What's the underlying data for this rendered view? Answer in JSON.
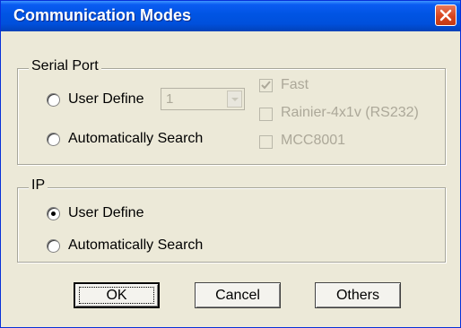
{
  "window": {
    "title": "Communication Modes"
  },
  "serial_port": {
    "group_label": "Serial Port",
    "user_define_label": "User Define",
    "auto_search_label": "Automatically Search",
    "port_value": "1",
    "options": [
      {
        "label": "Fast",
        "checked": true,
        "enabled": false
      },
      {
        "label": "Rainier-4x1v (RS232)",
        "checked": false,
        "enabled": false
      },
      {
        "label": "MCC8001",
        "checked": false,
        "enabled": false
      }
    ]
  },
  "ip": {
    "group_label": "IP",
    "user_define_label": "User Define",
    "auto_search_label": "Automatically Search",
    "selected": "User Define"
  },
  "buttons": {
    "ok": "OK",
    "cancel": "Cancel",
    "others": "Others"
  },
  "colors": {
    "title_bar": "#0054e3",
    "dialog_bg": "#ece9d8",
    "disabled_text": "#aca899",
    "close_button": "#d9451e"
  }
}
